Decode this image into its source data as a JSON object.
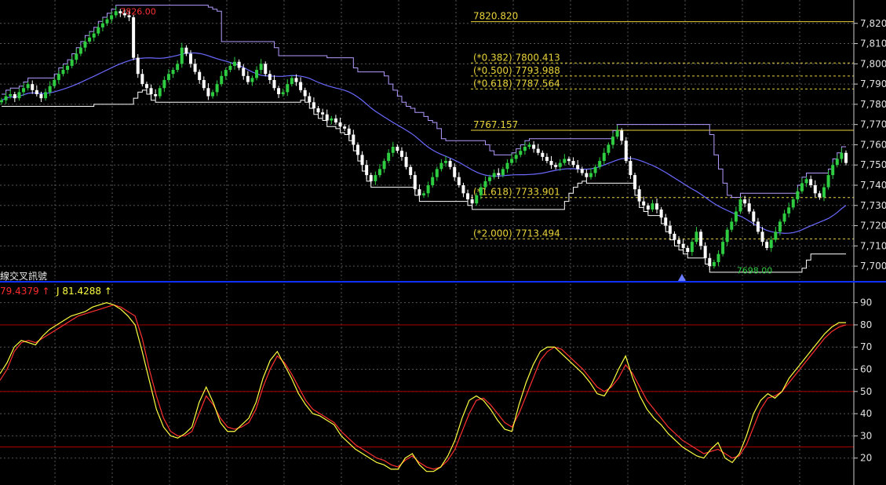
{
  "indicator_title": "線交叉訊號",
  "indicator_k": {
    "text": "79.4379 ↑"
  },
  "indicator_j": {
    "text": "J 81.4288 ↑"
  },
  "colors": {
    "background": "#000000",
    "grid": "#555555",
    "up_candle": "#2ecc40",
    "down_candle": "#ffffff",
    "ma_line": "#6a6aff",
    "upper_channel": "#b49bff",
    "lower_channel": "#ffffff",
    "fib_line": "#e8d23a",
    "price_marker": "#ff3030",
    "k_line": "#ff3030",
    "d_line": "#ffff40",
    "ref_line": "#aa0000",
    "separator": "#1030ff"
  },
  "chart_data": [
    {
      "type": "candlestick",
      "name": "price",
      "ylim": [
        7695,
        7830
      ],
      "yticks": [
        "7,700",
        "7,710",
        "7,720",
        "7,730",
        "7,740",
        "7,750",
        "7,760",
        "7,770",
        "7,780",
        "7,790",
        "7,800",
        "7,810",
        "7,820"
      ],
      "ytick_values": [
        7700,
        7710,
        7720,
        7730,
        7740,
        7750,
        7760,
        7770,
        7780,
        7790,
        7800,
        7810,
        7820
      ],
      "fib_levels": [
        {
          "label": "7820.820",
          "value": 7820.82,
          "style": "solid"
        },
        {
          "label": "(*0.382) 7800.413",
          "value": 7800.413,
          "style": "dashed"
        },
        {
          "label": "(*0.500) 7793.988",
          "value": 7793.988,
          "style": "dashed"
        },
        {
          "label": "(*0.618) 7787.564",
          "value": 7787.564,
          "style": "dashed"
        },
        {
          "label": "7767.157",
          "value": 7767.157,
          "style": "solid"
        },
        {
          "label": "(*1.618) 7733.901",
          "value": 7733.901,
          "style": "dashed"
        },
        {
          "label": "(*2.000) 7713.494",
          "value": 7713.494,
          "style": "dashed"
        }
      ],
      "annotations": [
        {
          "label": "7826.00",
          "value": 7826,
          "at": 0.135
        },
        {
          "label": "7698.00",
          "value": 7698,
          "at": 0.865
        }
      ],
      "close": [
        7782,
        7784,
        7785,
        7783,
        7786,
        7788,
        7790,
        7787,
        7785,
        7783,
        7786,
        7789,
        7792,
        7795,
        7797,
        7799,
        7802,
        7805,
        7808,
        7811,
        7813,
        7815,
        7818,
        7820,
        7822,
        7824,
        7826,
        7825,
        7824,
        7823,
        7803,
        7795,
        7790,
        7788,
        7785,
        7784,
        7788,
        7792,
        7795,
        7797,
        7800,
        7808,
        7805,
        7800,
        7796,
        7792,
        7788,
        7784,
        7786,
        7790,
        7794,
        7797,
        7799,
        7801,
        7798,
        7794,
        7791,
        7793,
        7797,
        7800,
        7795,
        7792,
        7788,
        7785,
        7786,
        7790,
        7793,
        7791,
        7787,
        7784,
        7781,
        7778,
        7776,
        7775,
        7772,
        7773,
        7771,
        7769,
        7768,
        7765,
        7760,
        7755,
        7750,
        7745,
        7742,
        7745,
        7748,
        7752,
        7756,
        7759,
        7757,
        7754,
        7749,
        7745,
        7738,
        7735,
        7736,
        7740,
        7744,
        7748,
        7751,
        7752,
        7749,
        7744,
        7740,
        7736,
        7733,
        7731,
        7735,
        7739,
        7742,
        7744,
        7746,
        7745,
        7748,
        7751,
        7753,
        7755,
        7757,
        7759,
        7760,
        7758,
        7756,
        7754,
        7752,
        7750,
        7749,
        7751,
        7753,
        7752,
        7750,
        7748,
        7746,
        7744,
        7746,
        7749,
        7752,
        7756,
        7760,
        7764,
        7767,
        7762,
        7752,
        7745,
        7738,
        7732,
        7730,
        7728,
        7731,
        7728,
        7724,
        7720,
        7716,
        7713,
        7711,
        7709,
        7707,
        7712,
        7717,
        7710,
        7704,
        7700,
        7702,
        7706,
        7712,
        7718,
        7722,
        7727,
        7733,
        7731,
        7727,
        7722,
        7717,
        7712,
        7709,
        7713,
        7717,
        7722,
        7726,
        7729,
        7733,
        7737,
        7741,
        7743,
        7740,
        7736,
        7734,
        7739,
        7745,
        7750,
        7753,
        7756,
        7751
      ]
    },
    {
      "type": "line",
      "name": "oscillator",
      "ylim": [
        10,
        92
      ],
      "yticks": [
        "90",
        "80",
        "70",
        "60",
        "50",
        "40",
        "30",
        "20"
      ],
      "ytick_values": [
        90,
        80,
        70,
        60,
        50,
        40,
        30,
        20
      ],
      "ref_lines": [
        80,
        50,
        25
      ],
      "series": [
        {
          "name": "K",
          "color": "#ff3030",
          "values": [
            55,
            60,
            68,
            72,
            73,
            72,
            74,
            76,
            78,
            80,
            82,
            84,
            85,
            86,
            87,
            88,
            89,
            88,
            86,
            84,
            74,
            60,
            48,
            38,
            32,
            30,
            30,
            32,
            40,
            48,
            44,
            38,
            34,
            33,
            34,
            36,
            42,
            52,
            60,
            66,
            63,
            58,
            52,
            46,
            42,
            40,
            38,
            36,
            32,
            29,
            26,
            24,
            22,
            20,
            19,
            17,
            16,
            19,
            21,
            18,
            16,
            15,
            16,
            19,
            24,
            32,
            40,
            46,
            47,
            44,
            40,
            36,
            34,
            40,
            48,
            56,
            64,
            68,
            70,
            69,
            66,
            63,
            60,
            56,
            52,
            50,
            52,
            56,
            62,
            58,
            52,
            46,
            42,
            38,
            34,
            31,
            28,
            26,
            24,
            22,
            23,
            24,
            22,
            20,
            21,
            26,
            34,
            42,
            47,
            48,
            50,
            54,
            58,
            62,
            66,
            70,
            74,
            77,
            79,
            80
          ]
        },
        {
          "name": "D",
          "color": "#ffff40",
          "values": [
            58,
            63,
            70,
            73,
            72,
            71,
            75,
            78,
            80,
            82,
            84,
            85,
            86,
            88,
            89,
            90,
            89,
            87,
            84,
            80,
            68,
            55,
            42,
            34,
            30,
            29,
            31,
            34,
            45,
            52,
            45,
            36,
            32,
            32,
            35,
            38,
            45,
            56,
            64,
            68,
            62,
            56,
            49,
            44,
            40,
            39,
            37,
            35,
            30,
            27,
            24,
            22,
            20,
            18,
            17,
            15,
            15,
            20,
            22,
            17,
            14,
            14,
            16,
            21,
            28,
            38,
            46,
            48,
            46,
            42,
            37,
            33,
            32,
            44,
            54,
            62,
            68,
            70,
            70,
            67,
            64,
            61,
            58,
            54,
            49,
            48,
            53,
            60,
            66,
            56,
            48,
            42,
            38,
            35,
            31,
            28,
            25,
            23,
            21,
            20,
            24,
            27,
            20,
            18,
            22,
            30,
            40,
            46,
            49,
            47,
            50,
            56,
            60,
            64,
            68,
            72,
            76,
            79,
            81,
            81
          ]
        }
      ]
    }
  ]
}
